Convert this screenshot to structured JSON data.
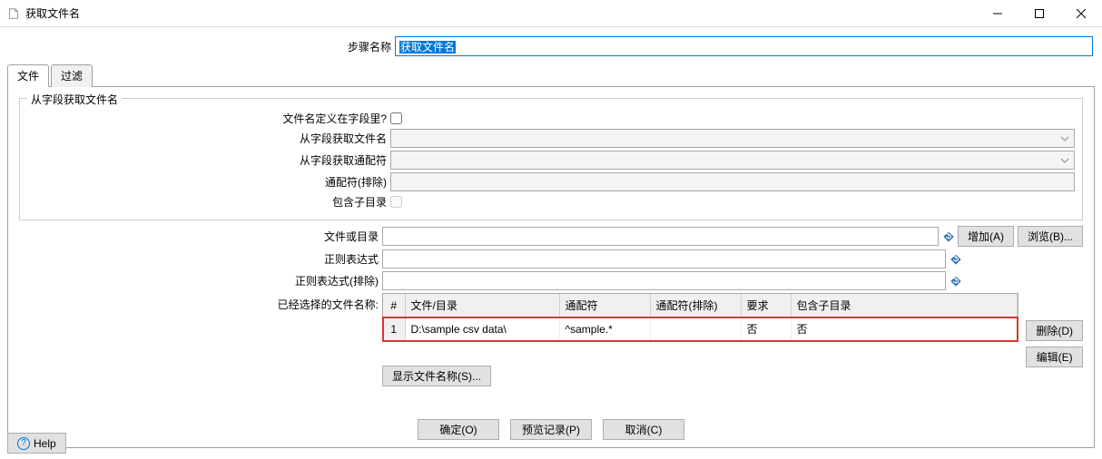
{
  "window": {
    "title": "获取文件名"
  },
  "stepName": {
    "label": "步骤名称",
    "value": "获取文件名"
  },
  "tabs": {
    "file": "文件",
    "filter": "过滤"
  },
  "fieldset": {
    "legend": "从字段获取文件名",
    "defined_in_field_label": "文件名定义在字段里?",
    "defined_in_field_checked": false,
    "filename_from_field_label": "从字段获取文件名",
    "wildcard_from_field_label": "从字段获取通配符",
    "wildcard_exclude_label": "通配符(排除)",
    "include_subdir_label": "包含子目录"
  },
  "fileOrDir": {
    "label": "文件或目录",
    "value": "",
    "add_btn": "增加(A)",
    "browse_btn": "浏览(B)..."
  },
  "regex": {
    "label": "正则表达式",
    "value": ""
  },
  "regexExclude": {
    "label": "正则表达式(排除)",
    "value": ""
  },
  "selectedFiles": {
    "label": "已经选择的文件名称:",
    "columns": {
      "num": "#",
      "file_dir": "文件/目录",
      "wildcard": "通配符",
      "wildcard_exclude": "通配符(排除)",
      "require": "要求",
      "include_sub": "包含子目录"
    },
    "rows": [
      {
        "num": "1",
        "file_dir": "D:\\sample csv data\\",
        "wildcard": "^sample.*",
        "wildcard_exclude": "",
        "require": "否",
        "include_sub": "否"
      }
    ],
    "delete_btn": "删除(D)",
    "edit_btn": "编辑(E)",
    "show_names_btn": "显示文件名称(S)..."
  },
  "bottom": {
    "ok": "确定(O)",
    "preview": "预览记录(P)",
    "cancel": "取消(C)"
  },
  "help": "Help"
}
